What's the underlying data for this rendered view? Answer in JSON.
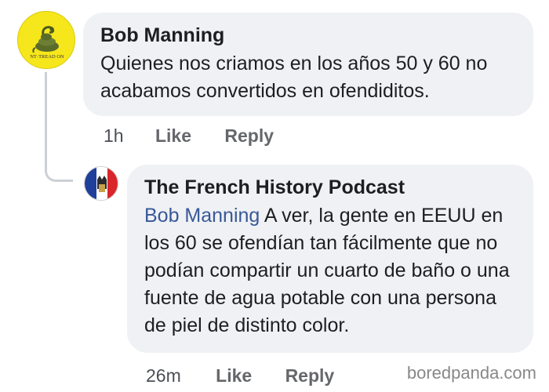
{
  "comment": {
    "author": "Bob Manning",
    "text": "Quienes nos criamos en los años 50 y 60 no acabamos convertidos en ofendiditos.",
    "avatar_label": "NT·TREAD ON",
    "time": "1h",
    "like_label": "Like",
    "reply_label": "Reply"
  },
  "reply": {
    "author": "The French History Podcast",
    "mention": "Bob Manning",
    "text": "A ver, la gente en EEUU en los 60 se ofendían tan fácilmente que no podían compartir un cuarto de baño o una fuente de agua potable con una persona de piel de distinto color.",
    "time": "26m",
    "like_label": "Like",
    "reply_label": "Reply"
  },
  "watermark": "boredpanda.com",
  "colors": {
    "bubble": "#eff1f4",
    "mention": "#385898",
    "meta": "#65676b",
    "avatar_yellow": "#f6e61c"
  },
  "icons": {
    "avatar_1": "gadsden-flag-snake-icon",
    "avatar_2": "french-flag-icon"
  }
}
